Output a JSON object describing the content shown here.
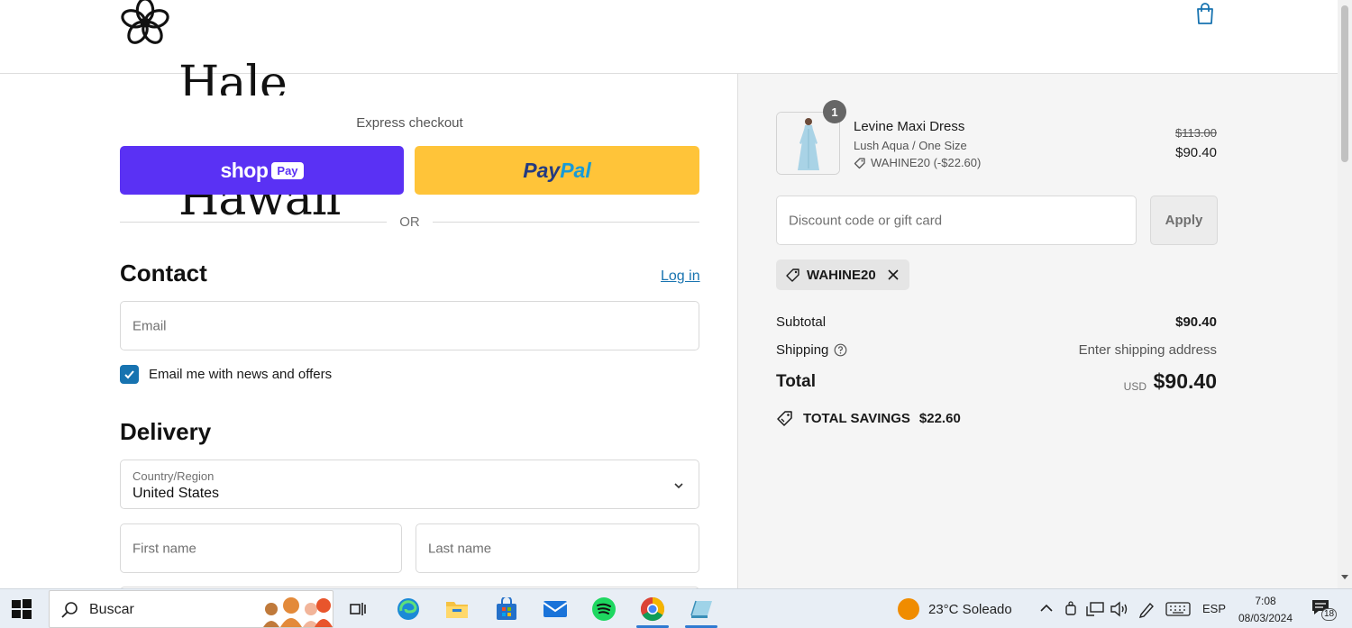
{
  "header": {
    "logo_line1": "Hale",
    "logo_line2": "Hawaii",
    "cart_icon": "shopping-bag-icon"
  },
  "express": {
    "title": "Express checkout",
    "shoppay_label": "shop",
    "shoppay_pill": "Pay",
    "paypal_pay": "Pay",
    "paypal_pal": "Pal",
    "or_text": "OR"
  },
  "contact": {
    "title": "Contact",
    "login_link": "Log in",
    "email_placeholder": "Email",
    "newsletter_label": "Email me with news and offers",
    "newsletter_checked": true
  },
  "delivery": {
    "title": "Delivery",
    "country_label": "Country/Region",
    "country_value": "United States",
    "first_name_placeholder": "First name",
    "last_name_placeholder": "Last name"
  },
  "summary": {
    "product": {
      "quantity": "1",
      "name": "Levine Maxi Dress",
      "variant": "Lush Aqua / One Size",
      "discount": "WAHINE20 (-$22.60)",
      "price_original": "$113.00",
      "price_current": "$90.40"
    },
    "discount_placeholder": "Discount code or gift card",
    "apply_label": "Apply",
    "applied_code": "WAHINE20",
    "subtotal_label": "Subtotal",
    "subtotal_value": "$90.40",
    "shipping_label": "Shipping",
    "shipping_value": "Enter shipping address",
    "total_label": "Total",
    "total_currency": "USD",
    "total_value": "$90.40",
    "savings_label": "TOTAL SAVINGS",
    "savings_value": "$22.60"
  },
  "taskbar": {
    "search_text": "Buscar",
    "weather_text": "23°C  Soleado",
    "language": "ESP",
    "time": "7:08",
    "date": "08/03/2024",
    "notification_count": "18"
  },
  "colors": {
    "shoppay": "#5a31f4",
    "paypal": "#ffc439",
    "link": "#1773b0"
  }
}
